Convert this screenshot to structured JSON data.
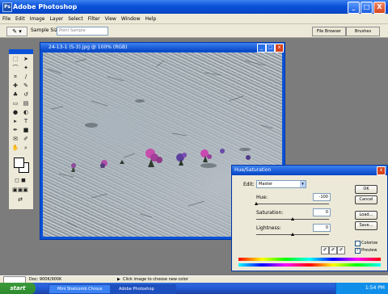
{
  "app": {
    "title": "Adobe Photoshop",
    "icon": "photoshop-icon"
  },
  "window_controls": [
    "_",
    "□",
    "X"
  ],
  "menu": [
    "File",
    "Edit",
    "Image",
    "Layer",
    "Select",
    "Filter",
    "View",
    "Window",
    "Help"
  ],
  "options": {
    "sample_size_label": "Sample Size:",
    "sample_size_value": "Point Sample"
  },
  "palette_well": {
    "tab1": "File Browser",
    "tab2": "Brushes"
  },
  "document": {
    "title": "24-13-1 (5-3).jpg @ 100% (RGB)"
  },
  "hue_saturation": {
    "title": "Hue/Saturation",
    "edit_label": "Edit:",
    "edit_value": "Master",
    "hue_label": "Hue:",
    "hue_value": "-100",
    "saturation_label": "Saturation:",
    "saturation_value": "0",
    "lightness_label": "Lightness:",
    "lightness_value": "0",
    "ok": "OK",
    "cancel": "Cancel",
    "load": "Load...",
    "save": "Save...",
    "colorize": "Colorize",
    "preview": "Preview",
    "preview_checked": "✓"
  },
  "status": {
    "doc": "Doc: 900K/900K",
    "hint": "Click image to choose new color"
  },
  "taskbar": {
    "start": "start",
    "tasks": [
      "Mini Shelcomb Chrous",
      "Adobe Photoshop"
    ],
    "clock": "1:54 PM"
  },
  "colors": {
    "title_blue": "#0a52d8",
    "dialog_bg": "#ece9d8",
    "flower_pink": "#c64fae"
  }
}
